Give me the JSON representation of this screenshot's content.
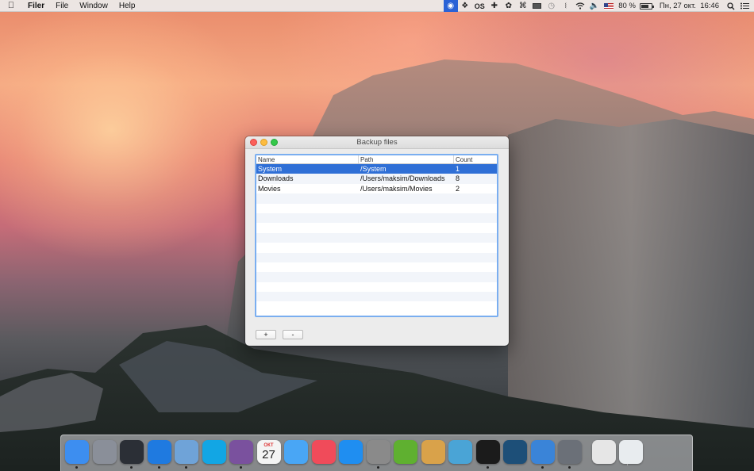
{
  "menubar": {
    "apple_icon": "apple-icon",
    "app_name": "Filer",
    "menus": [
      "File",
      "Window",
      "Help"
    ],
    "battery_percent": "80 %",
    "battery_level": 0.8,
    "datetime": "Пн, 27 окт.  16:46",
    "status_icons": [
      "1password-icon",
      "dropbox-icon",
      "os-icon",
      "plus-icon",
      "bird-icon",
      "command-icon",
      "screen-icon",
      "timemachine-icon",
      "bluetooth-icon",
      "wifi-icon",
      "volume-icon",
      "flag-us-icon",
      "battery-icon",
      "search-icon",
      "list-icon"
    ],
    "status_texts": {
      "os": "OS",
      "plus": "✚",
      "command": "⌘"
    }
  },
  "window": {
    "title": "Backup files",
    "columns": [
      "Name",
      "Path",
      "Count"
    ],
    "rows": [
      {
        "name": "System",
        "path": "/System",
        "count": "1",
        "selected": true
      },
      {
        "name": "Downloads",
        "path": "/Users/maksim/Downloads",
        "count": "8",
        "selected": false
      },
      {
        "name": "Movies",
        "path": "/Users/maksim/Movies",
        "count": "2",
        "selected": false
      }
    ],
    "add_label": "+",
    "remove_label": "-"
  },
  "dock": {
    "apps": [
      {
        "name": "finder",
        "color": "#3d8ef0",
        "running": true
      },
      {
        "name": "launchpad",
        "color": "#8a8f99",
        "running": false
      },
      {
        "name": "mission-control",
        "color": "#2b2f36",
        "running": true
      },
      {
        "name": "safari",
        "color": "#1f7ae0",
        "running": true
      },
      {
        "name": "preview",
        "color": "#6fa3d8",
        "running": true
      },
      {
        "name": "skype",
        "color": "#12a6e4",
        "running": false
      },
      {
        "name": "viber",
        "color": "#7a519e",
        "running": true
      },
      {
        "name": "calendar",
        "color": "#f4f4f4",
        "running": false,
        "text": "27",
        "label": "ОКТ"
      },
      {
        "name": "messages",
        "color": "#49a6f5",
        "running": false
      },
      {
        "name": "itunes",
        "color": "#f04b5a",
        "running": false
      },
      {
        "name": "app-store",
        "color": "#1f8ef1",
        "running": false
      },
      {
        "name": "system-preferences",
        "color": "#8a8a8a",
        "running": true
      },
      {
        "name": "coda",
        "color": "#5fb030",
        "running": false
      },
      {
        "name": "box-app",
        "color": "#d9a24a",
        "running": false
      },
      {
        "name": "xcode-simulator",
        "color": "#4aa4d6",
        "running": false
      },
      {
        "name": "terminal",
        "color": "#1b1b1b",
        "running": true
      },
      {
        "name": "sourcetree",
        "color": "#1d4f78",
        "running": false
      },
      {
        "name": "xcode",
        "color": "#3a84d8",
        "running": true
      },
      {
        "name": "disk-utility",
        "color": "#6b7078",
        "running": true
      },
      {
        "name": "downloads-stack",
        "color": "#e6e6e6",
        "running": false
      },
      {
        "name": "trash",
        "color": "#e8ecef",
        "running": false
      }
    ]
  }
}
